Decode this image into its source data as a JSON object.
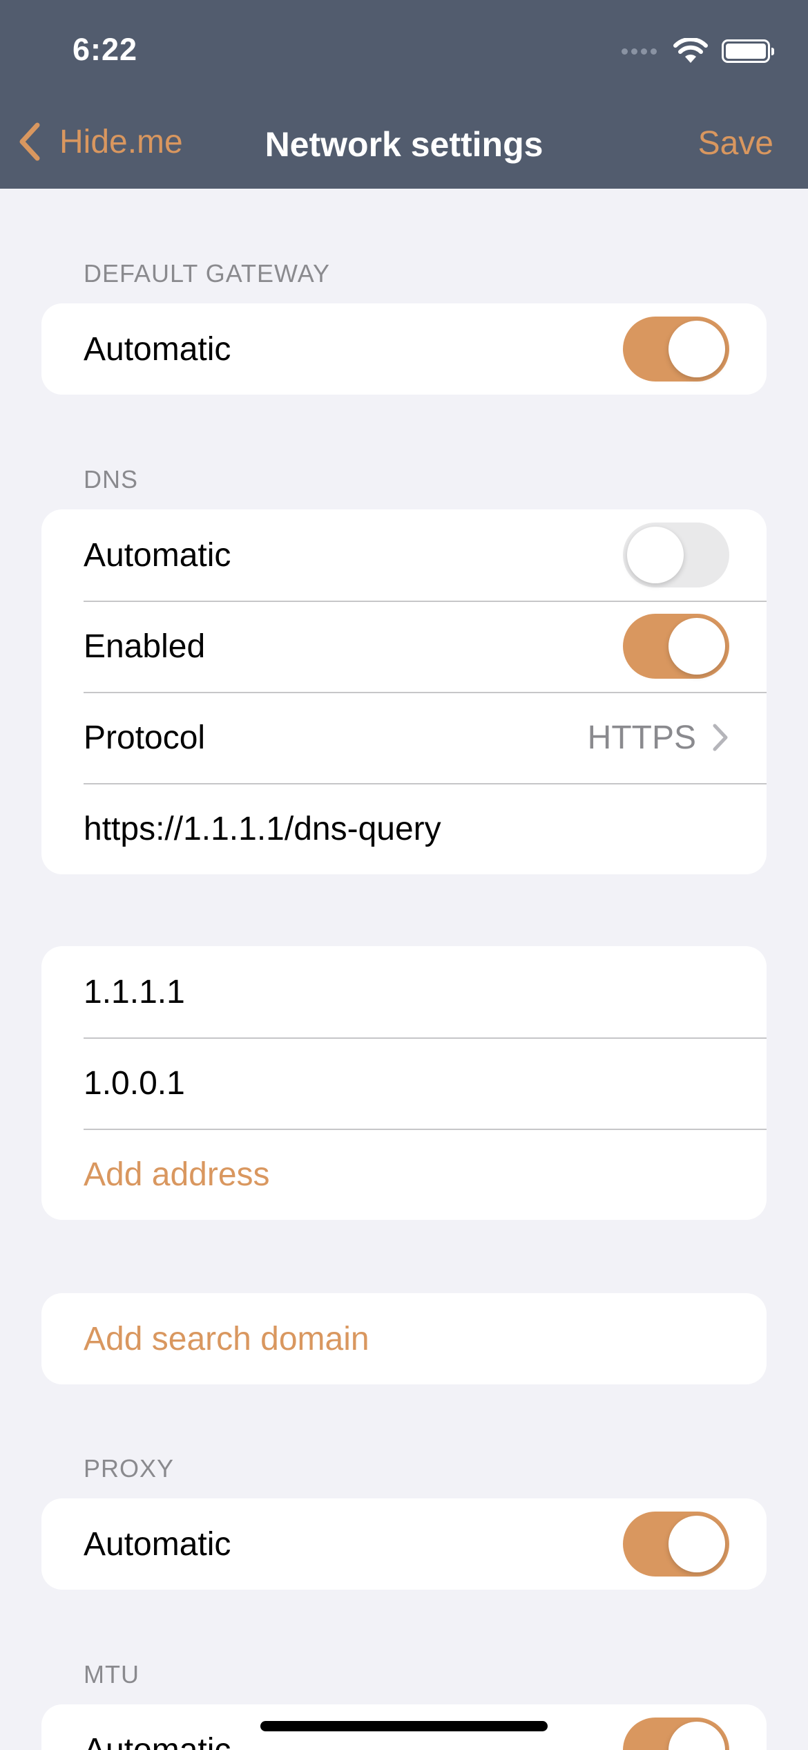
{
  "status_bar": {
    "time": "6:22"
  },
  "nav": {
    "back_label": "Hide.me",
    "title": "Network settings",
    "save_label": "Save"
  },
  "colors": {
    "accent": "#d9975f",
    "header_bg": "#525c6e",
    "background": "#f2f2f7"
  },
  "default_gateway": {
    "header": "DEFAULT GATEWAY",
    "automatic": {
      "label": "Automatic",
      "on": true
    }
  },
  "dns": {
    "header": "DNS",
    "automatic": {
      "label": "Automatic",
      "on": false
    },
    "enabled": {
      "label": "Enabled",
      "on": true
    },
    "protocol": {
      "label": "Protocol",
      "value": "HTTPS"
    },
    "url": "https://1.1.1.1/dns-query"
  },
  "addresses": {
    "items": [
      "1.1.1.1",
      "1.0.0.1"
    ],
    "add_label": "Add address"
  },
  "search_domain": {
    "add_label": "Add search domain"
  },
  "proxy": {
    "header": "PROXY",
    "automatic": {
      "label": "Automatic",
      "on": true
    }
  },
  "mtu": {
    "header": "MTU",
    "automatic": {
      "label": "Automatic",
      "on": true
    }
  }
}
